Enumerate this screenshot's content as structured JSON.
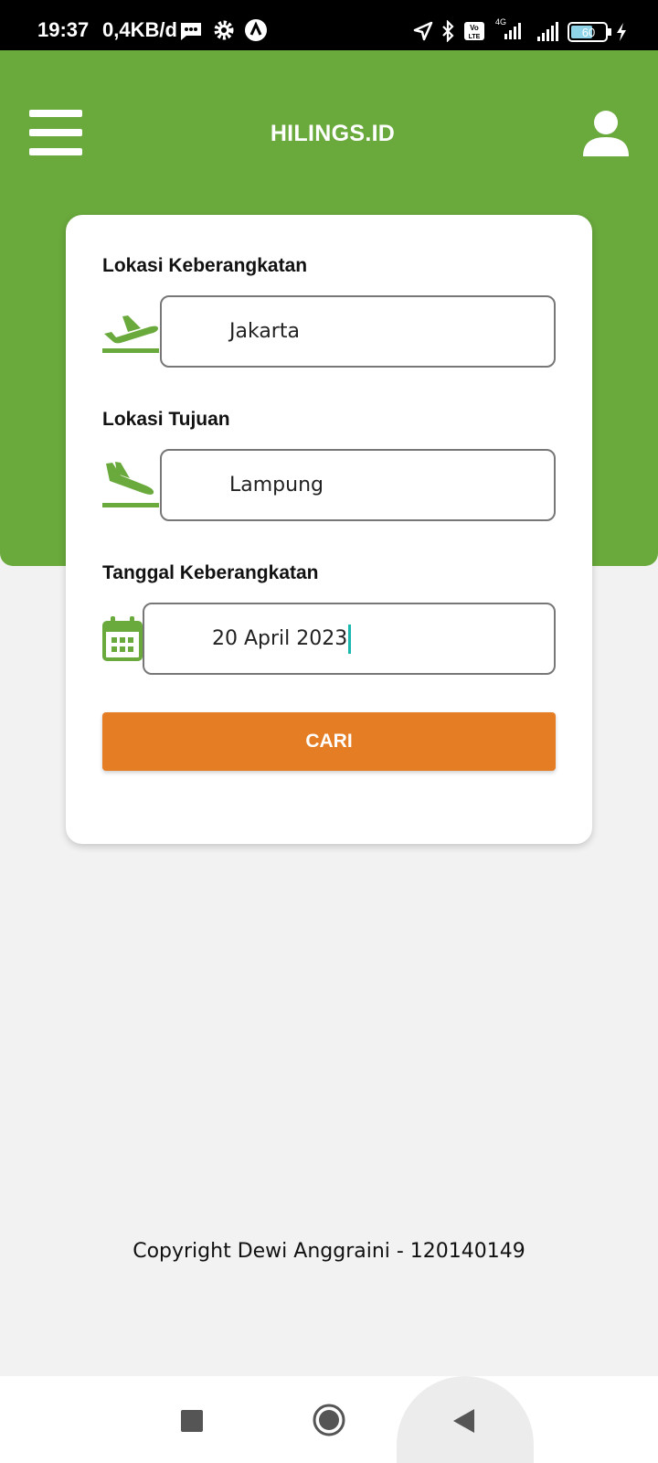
{
  "status_bar": {
    "time": "19:37",
    "network_speed": "0,4KB/d",
    "battery": "60",
    "icons": [
      "message-icon",
      "settings-icon",
      "app-notification-icon",
      "location-icon",
      "bluetooth-icon",
      "volte-icon",
      "signal-4g-icon",
      "signal-icon",
      "battery-icon",
      "charging-icon"
    ],
    "volte_label": "Vo LTE",
    "network_type": "4G"
  },
  "header": {
    "title": "HILINGS.ID",
    "menu_icon": "hamburger-menu-icon",
    "profile_icon": "user-icon",
    "color": "#6aa93c"
  },
  "form": {
    "departure": {
      "label": "Lokasi Keberangkatan",
      "value": "Jakarta",
      "icon": "flight-takeoff-icon"
    },
    "destination": {
      "label": "Lokasi Tujuan",
      "value": "Lampung",
      "icon": "flight-land-icon"
    },
    "date": {
      "label": "Tanggal Keberangkatan",
      "value": "20 April 2023",
      "icon": "calendar-icon"
    },
    "search_button": {
      "label": "CARI",
      "color": "#e57d25"
    }
  },
  "footer": {
    "copyright": "Copyright Dewi Anggraini - 120140149"
  },
  "nav_bar": {
    "buttons": [
      "recent-apps-icon",
      "home-icon",
      "back-icon"
    ]
  }
}
